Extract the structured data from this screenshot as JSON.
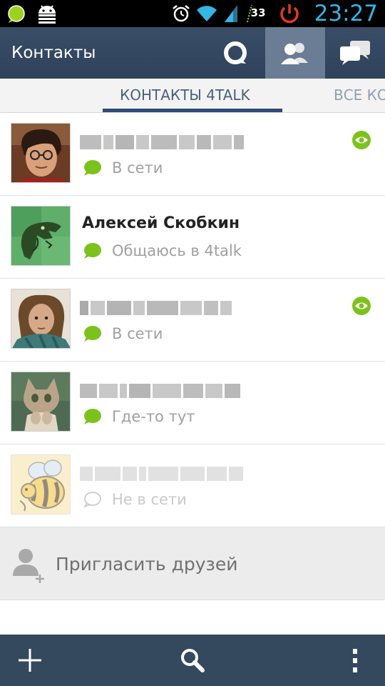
{
  "statusbar": {
    "time": "23:27",
    "battery_level": "33",
    "icons": [
      "chat-notification-icon",
      "android-icon",
      "alarm-icon",
      "wifi-icon",
      "signal-icon",
      "battery-icon",
      "power-icon"
    ]
  },
  "actionbar": {
    "title": "Контакты",
    "buttons": [
      "status-icon",
      "contacts-icon",
      "chats-icon"
    ],
    "active_button": "contacts-icon"
  },
  "tabs": [
    {
      "label": "КОНТАКТЫ 4TALK",
      "selected": true
    },
    {
      "label": "ВСЕ КО",
      "selected": false
    }
  ],
  "contacts": [
    {
      "name": "",
      "name_blurred": true,
      "status": "В сети",
      "online": true,
      "watched": true,
      "avatar": "man-with-glasses"
    },
    {
      "name": "Алексей Скобкин",
      "name_blurred": false,
      "status": "Общаюсь в 4talk",
      "online": true,
      "watched": false,
      "avatar": "philosoraptor"
    },
    {
      "name": "",
      "name_blurred": true,
      "status": "В сети",
      "online": true,
      "watched": true,
      "avatar": "woman-with-scarf"
    },
    {
      "name": "",
      "name_blurred": true,
      "status": "Где-то тут",
      "online": true,
      "watched": false,
      "avatar": "kitten"
    },
    {
      "name": "",
      "name_blurred": true,
      "status": "Не в сети",
      "online": false,
      "watched": false,
      "avatar": "cartoon-bee"
    }
  ],
  "invite": {
    "label": "Пригласить друзей"
  },
  "bottombar": {
    "buttons": [
      "add-icon",
      "search-icon",
      "overflow-menu-icon"
    ]
  },
  "colors": {
    "actionbar": "#34495e",
    "online_green": "#7cc21d",
    "time_blue": "#33b5e5",
    "tab_indicator": "#2e4a7a"
  }
}
